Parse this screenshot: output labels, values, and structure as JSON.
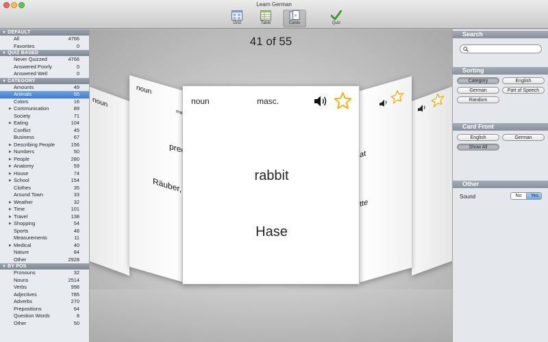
{
  "window": {
    "title": "Learn German",
    "toolbar": [
      {
        "label": "Grid",
        "icon": "grid-icon"
      },
      {
        "label": "Table",
        "icon": "table-icon"
      },
      {
        "label": "Cards",
        "icon": "cards-icon",
        "active": true
      },
      {
        "label": "Quiz",
        "icon": "quiz-checkmark-icon"
      }
    ]
  },
  "sidebar": {
    "sections": [
      {
        "title": "DEFAULT",
        "items": [
          {
            "label": "All",
            "count": "4766"
          },
          {
            "label": "Favorites",
            "count": "0"
          }
        ]
      },
      {
        "title": "QUIZ BASED",
        "items": [
          {
            "label": "Never Quizzed",
            "count": "4766"
          },
          {
            "label": "Answered Poorly",
            "count": "0"
          },
          {
            "label": "Answered Well",
            "count": "0"
          }
        ]
      },
      {
        "title": "CATEGORY",
        "items": [
          {
            "label": "Amounts",
            "count": "49"
          },
          {
            "label": "Animals",
            "count": "55",
            "selected": true
          },
          {
            "label": "Colors",
            "count": "16"
          },
          {
            "label": "Communication",
            "count": "89",
            "expandable": true
          },
          {
            "label": "Society",
            "count": "71"
          },
          {
            "label": "Eating",
            "count": "104",
            "expandable": true
          },
          {
            "label": "Conflict",
            "count": "45"
          },
          {
            "label": "Business",
            "count": "67"
          },
          {
            "label": "Describing People",
            "count": "156",
            "expandable": true
          },
          {
            "label": "Numbers",
            "count": "50",
            "expandable": true
          },
          {
            "label": "People",
            "count": "280",
            "expandable": true
          },
          {
            "label": "Anatomy",
            "count": "59",
            "expandable": true
          },
          {
            "label": "House",
            "count": "74",
            "expandable": true
          },
          {
            "label": "School",
            "count": "154",
            "expandable": true
          },
          {
            "label": "Clothes",
            "count": "35"
          },
          {
            "label": "Around Town",
            "count": "33"
          },
          {
            "label": "Weather",
            "count": "32",
            "expandable": true
          },
          {
            "label": "Time",
            "count": "101",
            "expandable": true
          },
          {
            "label": "Travel",
            "count": "138",
            "expandable": true
          },
          {
            "label": "Shopping",
            "count": "54",
            "expandable": true
          },
          {
            "label": "Sports",
            "count": "48"
          },
          {
            "label": "Measurements",
            "count": "11"
          },
          {
            "label": "Medical",
            "count": "40",
            "expandable": true
          },
          {
            "label": "Nature",
            "count": "84"
          },
          {
            "label": "Other",
            "count": "2928"
          }
        ]
      },
      {
        "title": "BY POS",
        "items": [
          {
            "label": "Pronouns",
            "count": "32"
          },
          {
            "label": "Nouns",
            "count": "2514"
          },
          {
            "label": "Verbs",
            "count": "998"
          },
          {
            "label": "Adjectives",
            "count": "785"
          },
          {
            "label": "Adverbs",
            "count": "270"
          },
          {
            "label": "Prepositions",
            "count": "64"
          },
          {
            "label": "Question Words",
            "count": "8"
          },
          {
            "label": "Other",
            "count": "50"
          }
        ]
      }
    ]
  },
  "main": {
    "counter": "41 of 55",
    "card": {
      "pos": "noun",
      "gender": "masc.",
      "english": "rabbit",
      "german": "Hase"
    },
    "left_card_near": {
      "pos": "noun",
      "gender_fragment": "ma",
      "english_fragment": "pred",
      "german_fragment": "Räuber, R"
    },
    "left_card_far": {
      "pos": "noun"
    },
    "right_card_near": {
      "english_fragment": "at",
      "german_fragment": "tte"
    }
  },
  "right_panel": {
    "search": {
      "title": "Search",
      "placeholder": ""
    },
    "sorting": {
      "title": "Sorting",
      "options": [
        "Category",
        "English",
        "German",
        "Part of Speech",
        "Random"
      ],
      "selected": "Category"
    },
    "card_front": {
      "title": "Card Front",
      "options": [
        "English",
        "German",
        "Show All"
      ],
      "selected": "Show All"
    },
    "other": {
      "title": "Other",
      "sound_label": "Sound",
      "no_label": "No",
      "yes_label": "Yes",
      "sound_value": "Yes"
    }
  },
  "colors": {
    "selection": "#3e7bd0",
    "star": "#f2b318",
    "section_header": "#87909b"
  }
}
